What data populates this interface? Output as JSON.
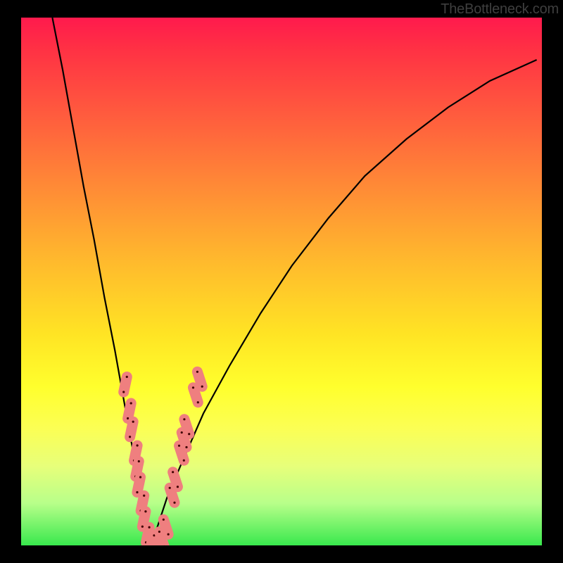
{
  "watermark": "TheBottleneck.com",
  "chart_data": {
    "type": "line",
    "title": "",
    "xlabel": "",
    "ylabel": "",
    "xlim": [
      0,
      100
    ],
    "ylim": [
      0,
      100
    ],
    "grid": false,
    "legend": false,
    "description": "Bottleneck curve: a sharp V-shaped dip reaching 0 near x≈25, rising steeply to both sides, with coral pill markers clustered along both flanks of the valley near the bottom.",
    "series": [
      {
        "name": "bottleneck-curve",
        "x": [
          6,
          8,
          10,
          12,
          14,
          16,
          18,
          20,
          22,
          24,
          25,
          26,
          28,
          31,
          35,
          40,
          46,
          52,
          59,
          66,
          74,
          82,
          90,
          99
        ],
        "y": [
          100,
          90,
          79,
          68,
          58,
          47,
          37,
          26,
          15,
          5,
          0,
          3,
          9,
          16,
          25,
          34,
          44,
          53,
          62,
          70,
          77,
          83,
          88,
          92
        ]
      }
    ],
    "markers": {
      "left_branch": [
        {
          "x": 20.0,
          "y": 30.5
        },
        {
          "x": 20.8,
          "y": 25.5
        },
        {
          "x": 21.2,
          "y": 22.0
        },
        {
          "x": 22.0,
          "y": 17.5
        },
        {
          "x": 22.3,
          "y": 14.5
        },
        {
          "x": 22.6,
          "y": 11.5
        },
        {
          "x": 23.3,
          "y": 8.0
        },
        {
          "x": 23.6,
          "y": 5.0
        },
        {
          "x": 24.3,
          "y": 2.0
        },
        {
          "x": 25.0,
          "y": 0.3
        }
      ],
      "right_branch": [
        {
          "x": 26.0,
          "y": 0.5
        },
        {
          "x": 27.0,
          "y": 1.2
        },
        {
          "x": 27.8,
          "y": 3.5
        },
        {
          "x": 29.0,
          "y": 9.5
        },
        {
          "x": 29.6,
          "y": 12.5
        },
        {
          "x": 30.8,
          "y": 17.5
        },
        {
          "x": 31.3,
          "y": 20.0
        },
        {
          "x": 31.8,
          "y": 22.5
        },
        {
          "x": 33.5,
          "y": 28.5
        },
        {
          "x": 34.3,
          "y": 31.5
        }
      ]
    },
    "colors": {
      "curve": "#000000",
      "marker_fill": "#ef7f7f",
      "marker_dot": "#400000",
      "gradient_top": "#ff1a4d",
      "gradient_bottom": "#39e84d"
    }
  }
}
